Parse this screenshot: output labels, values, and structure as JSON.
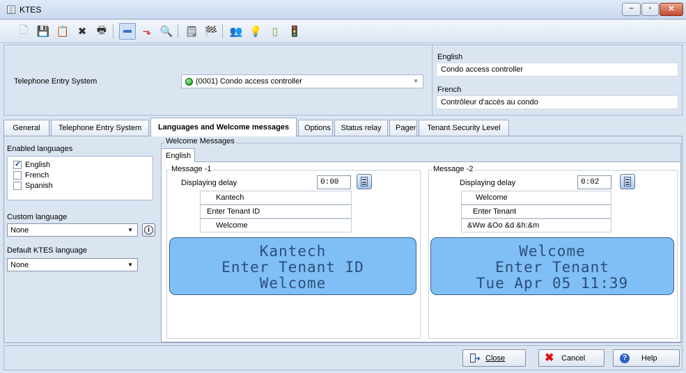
{
  "window": {
    "title": "KTES"
  },
  "toolbar": {
    "buttons": [
      "new-icon",
      "save-icon",
      "save-as-icon",
      "delete-icon",
      "print-icon",
      "minus-icon",
      "link-icon",
      "search-icon",
      "report-icon",
      "checkered-flag-icon",
      "users-icon",
      "light-bulb-icon",
      "door-icon",
      "traffic-light-icon"
    ]
  },
  "header": {
    "label": "Telephone Entry System",
    "controller": "(0001) Condo access controller",
    "english_label": "English",
    "english_value": "Condo access controller",
    "french_label": "French",
    "french_value": "Contrôleur d'accès au condo"
  },
  "tabs": [
    {
      "label": "General"
    },
    {
      "label": "Telephone Entry System"
    },
    {
      "label": "Languages and Welcome messages"
    },
    {
      "label": "Options"
    },
    {
      "label": "Status relay"
    },
    {
      "label": "Pager"
    },
    {
      "label": "Tenant Security Level"
    }
  ],
  "languages": {
    "enabled_label": "Enabled languages",
    "items": [
      {
        "label": "English",
        "checked": true
      },
      {
        "label": "French",
        "checked": false
      },
      {
        "label": "Spanish",
        "checked": false
      }
    ],
    "custom_label": "Custom language",
    "custom_value": "None",
    "default_label": "Default KTES language",
    "default_value": "None"
  },
  "welcome": {
    "legend": "Welcome Messages",
    "tab": "English",
    "delay_label": "Displaying delay",
    "messages": [
      {
        "legend": "Message -1",
        "delay": "0:00",
        "lines": [
          "Kantech",
          "Enter Tenant ID",
          "Welcome"
        ],
        "display": [
          "Kantech",
          "Enter Tenant ID",
          "Welcome"
        ]
      },
      {
        "legend": "Message -2",
        "delay": "0:02",
        "lines": [
          "Welcome",
          "Enter Tenant",
          "&Ww &Oo &d &h:&m"
        ],
        "display": [
          "Welcome",
          "Enter Tenant",
          "Tue Apr 05 11:39"
        ]
      }
    ]
  },
  "footer": {
    "close": "Close",
    "cancel": "Cancel",
    "help": "Help"
  }
}
